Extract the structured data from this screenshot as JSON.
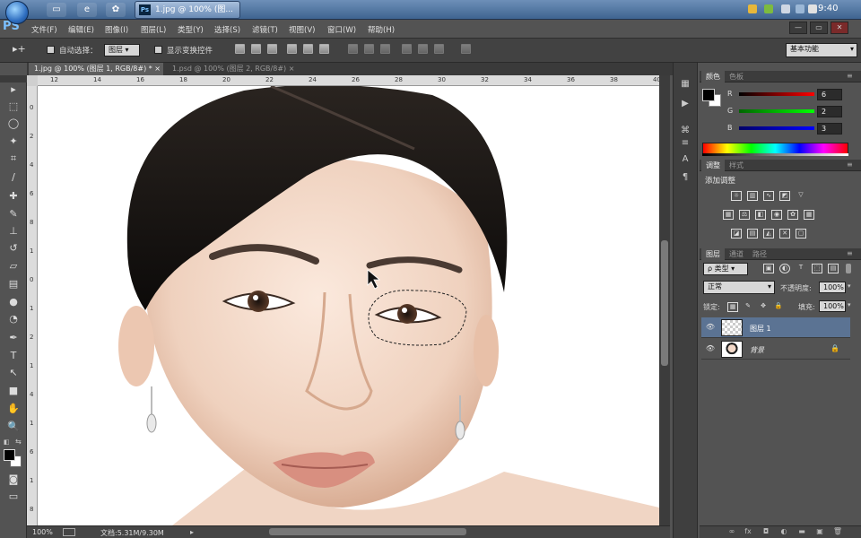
{
  "taskbar": {
    "task_title": "1.jpg @ 100% (图...",
    "task_app_badge": "Ps",
    "clock": "9:40"
  },
  "menubar": {
    "logo": "PS",
    "items": [
      "文件(F)",
      "编辑(E)",
      "图像(I)",
      "图层(L)",
      "类型(Y)",
      "选择(S)",
      "滤镜(T)",
      "视图(V)",
      "窗口(W)",
      "帮助(H)"
    ],
    "win_min": "—",
    "win_max": "▭",
    "win_close": "✕"
  },
  "options": {
    "auto_select_label": "自动选择：",
    "auto_select_value": "图层",
    "show_transform_label": "显示变换控件",
    "workspace": "基本功能"
  },
  "tabs": [
    {
      "label": "1.jpg @ 100% (图层 1, RGB/8#) *",
      "close": "×"
    },
    {
      "label": "1.psd @ 100% (图层 2, RGB/8#)",
      "close": "×"
    }
  ],
  "rulers": {
    "top": [
      "12",
      "14",
      "16",
      "18",
      "20",
      "22",
      "24",
      "26",
      "28",
      "30",
      "32",
      "34",
      "36",
      "38",
      "40"
    ],
    "left": [
      "0",
      "2",
      "4",
      "6",
      "8",
      "1",
      "0",
      "1",
      "2",
      "1",
      "4",
      "1",
      "6",
      "1",
      "8"
    ]
  },
  "status": {
    "zoom": "100%",
    "doc_info": "文档:5.31M/9.30M"
  },
  "color_panel": {
    "tabs": [
      "颜色",
      "色板"
    ],
    "r_label": "R",
    "r_value": "6",
    "g_label": "G",
    "g_value": "2",
    "b_label": "B",
    "b_value": "3"
  },
  "adjust_panel": {
    "tabs": [
      "调整",
      "样式"
    ],
    "title": "添加调整"
  },
  "layers_panel": {
    "tabs": [
      "图层",
      "通道",
      "路径"
    ],
    "filter_kind": "ρ 类型",
    "blend_mode": "正常",
    "opacity_label": "不透明度:",
    "opacity_value": "100%",
    "lock_label": "锁定:",
    "fill_label": "填充:",
    "fill_value": "100%",
    "layers": [
      {
        "name": "图层 1",
        "selected": true
      },
      {
        "name": "背景",
        "selected": false,
        "locked": true
      }
    ],
    "footer_icons": [
      "link-icon",
      "fx-icon",
      "mask-icon",
      "adjustment-icon",
      "group-icon",
      "new-layer-icon",
      "trash-icon"
    ]
  },
  "colors": {
    "accent_selected_layer": "#5b7393",
    "panel_bg": "#535353"
  }
}
